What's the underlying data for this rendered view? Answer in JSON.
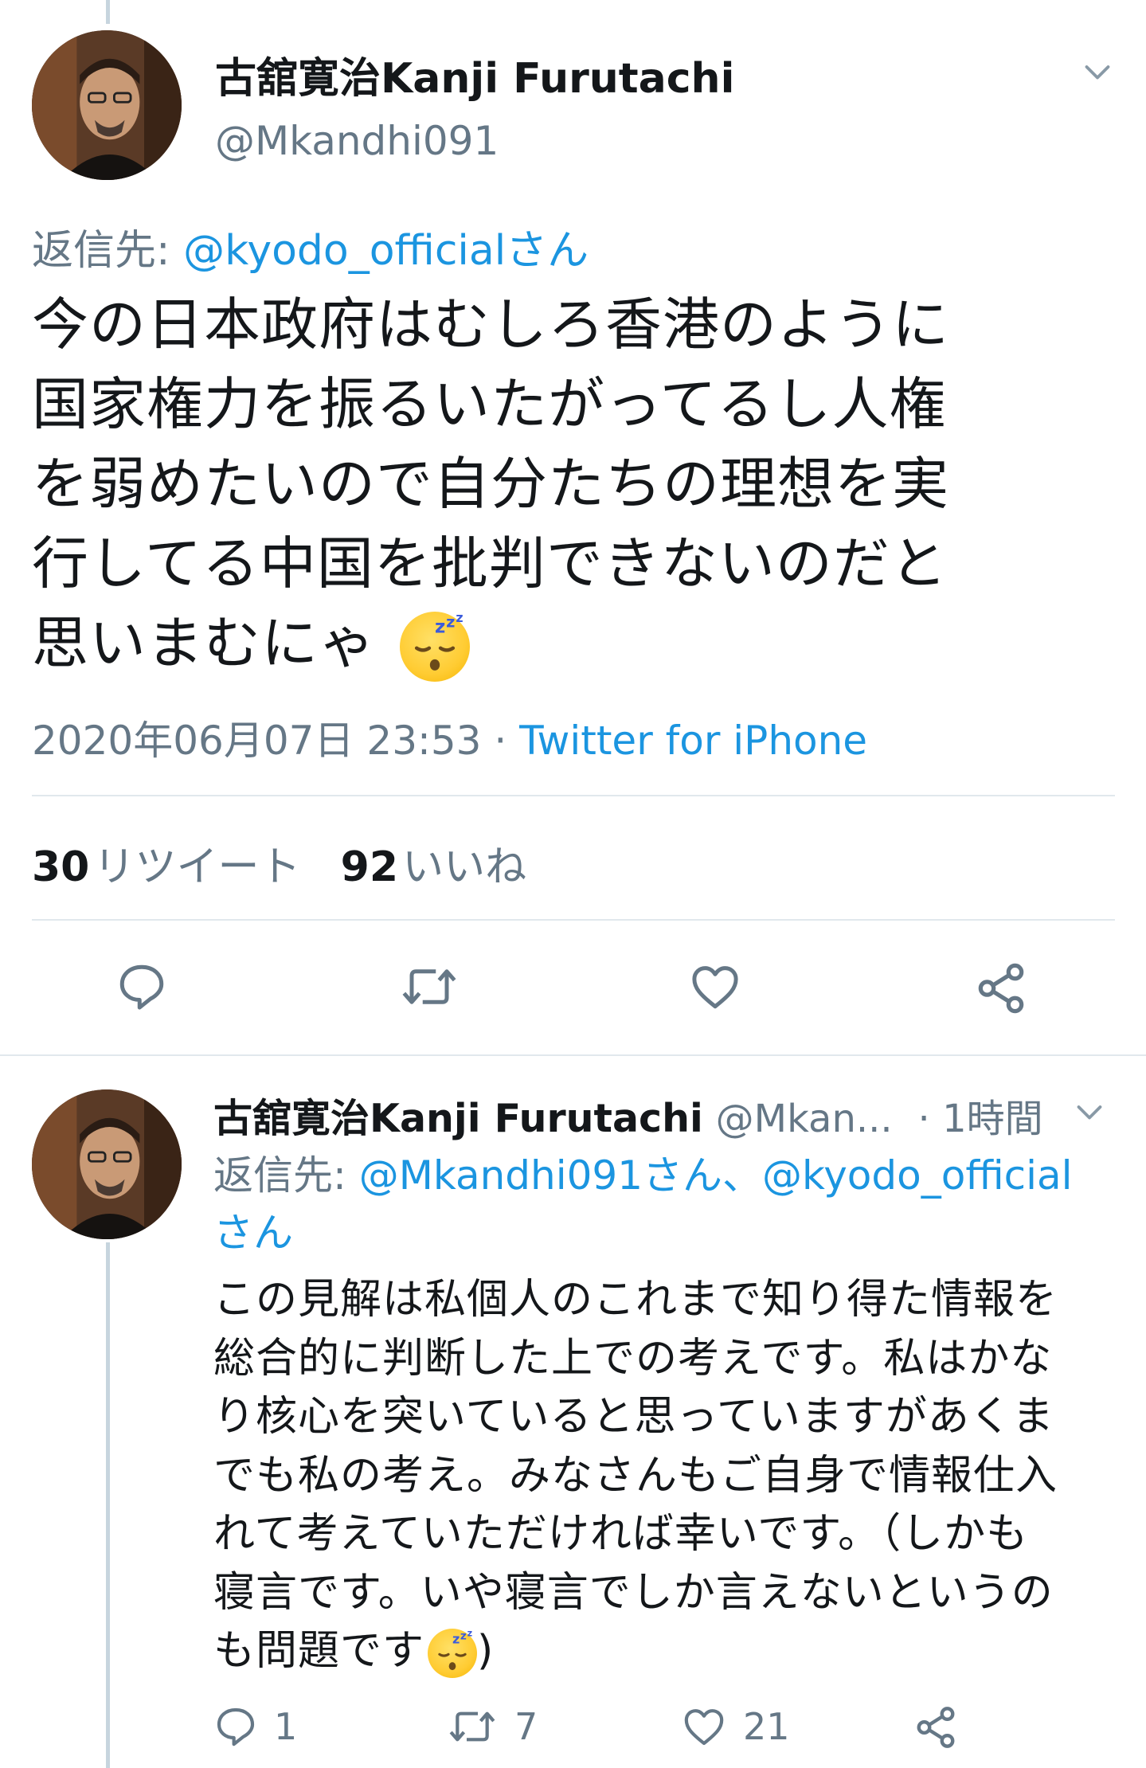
{
  "main_tweet": {
    "display_name": "古舘寛治Kanji Furutachi",
    "handle": "@Mkandhi091",
    "replying_to_prefix": "返信先: ",
    "replying_to_handle": "@kyodo_officialさん",
    "text_lines": [
      "今の日本政府はむしろ香港のように",
      "国家権力を振るいたがってるし人権",
      "を弱めたいので自分たちの理想を実",
      "行してる中国を批判できないのだと",
      "思いまむにゃ"
    ],
    "emoji": "sleeping-face",
    "timestamp": "2020年06月07日 23:53 · ",
    "source": "Twitter for iPhone",
    "retweet_count": "30",
    "retweet_label": "リツイート",
    "like_count": "92",
    "like_label": "いいね"
  },
  "reply_tweet": {
    "display_name": "古舘寛治Kanji Furutachi",
    "handle_truncated": "@Mkan...",
    "time": "· 1時間",
    "replying_to_prefix": "返信先: ",
    "replying_to_handles_line1": "@Mkandhi091さん、@kyodo_official",
    "replying_to_handles_line2": "さん",
    "text_lines": [
      "この見解は私個人のこれまで知り得た情報を",
      "総合的に判断した上での考えです。私はかな",
      "り核心を突いていると思っていますがあくま",
      "でも私の考え。みなさんもご自身で情報仕入",
      "れて考えていただければ幸いです。（しかも",
      "寝言です。いや寝言でしか言えないというの",
      "も問題です"
    ],
    "text_tail": ")",
    "emoji": "sleeping-face",
    "reply_count": "1",
    "retweet_count": "7",
    "like_count": "21"
  },
  "icons": [
    "chevron-down-icon",
    "reply-icon",
    "retweet-icon",
    "like-icon",
    "share-icon"
  ],
  "colors": {
    "link": "#1b95e0",
    "secondary_text": "#657786",
    "divider": "#e1e8ed",
    "thread_line": "#c7d5de"
  }
}
